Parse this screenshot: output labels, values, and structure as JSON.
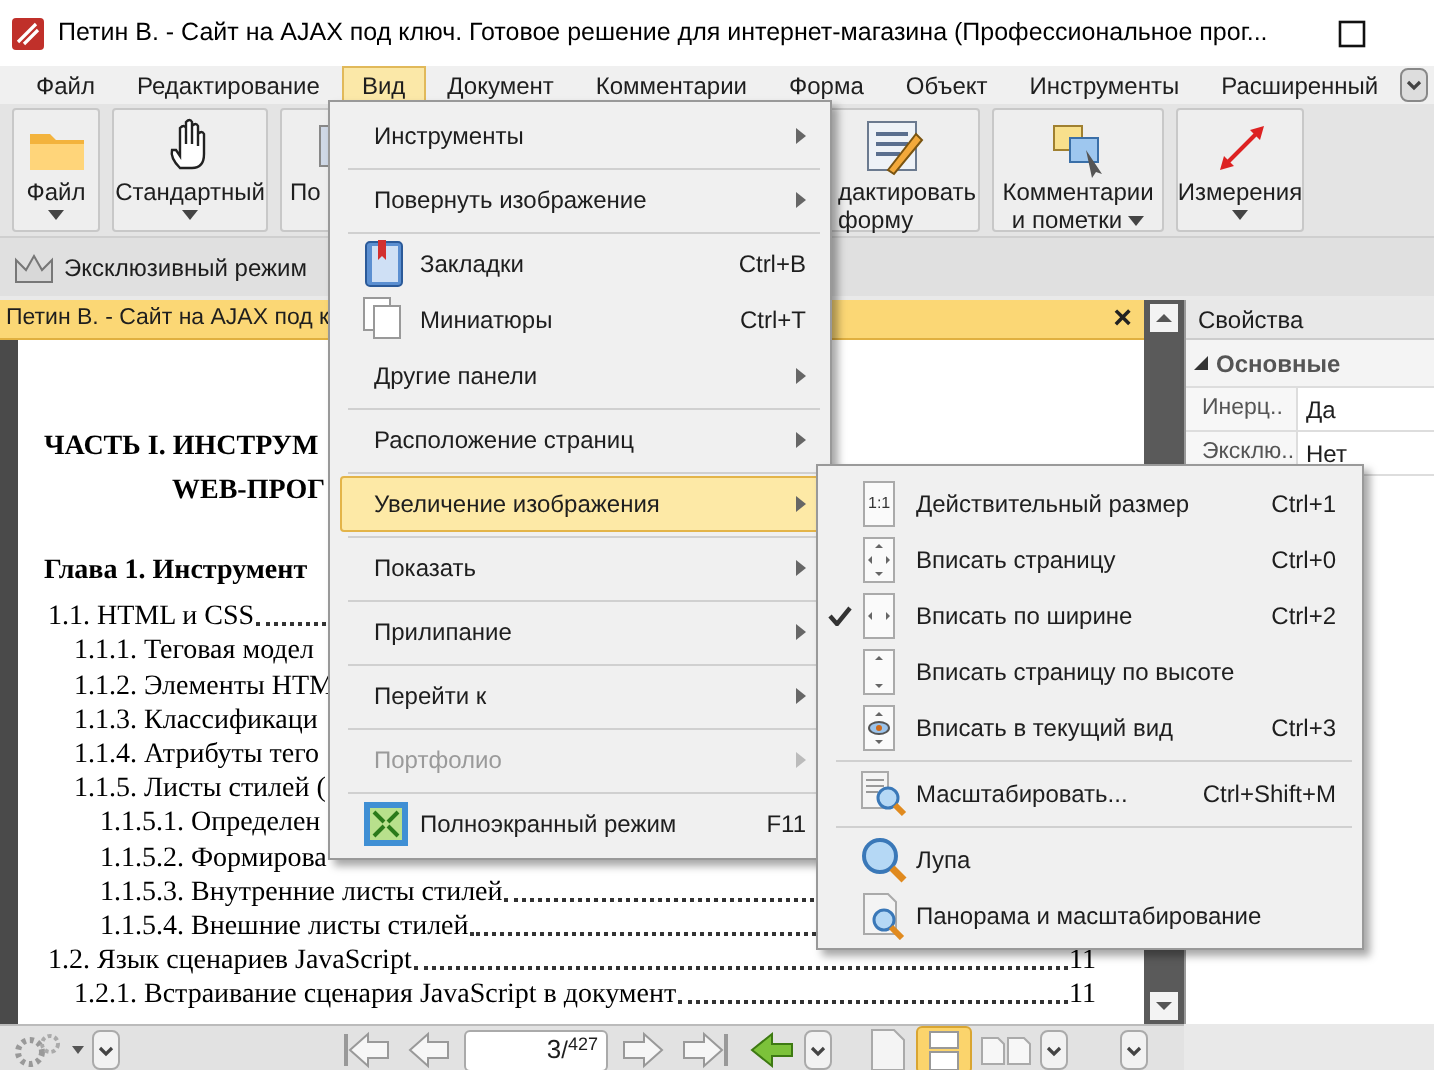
{
  "window": {
    "title": "Петин В. - Сайт на AJAX под ключ. Готовое решение для интернет-магазина (Профессиональное прог..."
  },
  "menu_bar": [
    {
      "label": "Файл",
      "selected": false
    },
    {
      "label": "Редактирование",
      "selected": false
    },
    {
      "label": "Вид",
      "selected": true
    },
    {
      "label": "Документ",
      "selected": false
    },
    {
      "label": "Комментарии",
      "selected": false
    },
    {
      "label": "Форма",
      "selected": false
    },
    {
      "label": "Объект",
      "selected": false
    },
    {
      "label": "Инструменты",
      "selected": false
    },
    {
      "label": "Расширенный",
      "selected": false
    }
  ],
  "ribbon_left": [
    {
      "label": "Файл",
      "dropdown": true
    },
    {
      "label": "Стандартный",
      "dropdown": true
    },
    {
      "label": "По"
    }
  ],
  "ribbon_right": [
    {
      "label": "дактировать форму"
    },
    {
      "label": "Комментарии и пометки",
      "dropdown": true
    },
    {
      "label": "Измерения",
      "dropdown": true
    }
  ],
  "toolbar": {
    "exclusive_mode": "Эксклюзивный режим"
  },
  "document_tab": {
    "title": "Петин В. - Сайт на AJAX под к",
    "close": "×"
  },
  "document": {
    "heading_lines": [
      "ЧАСТЬ I. ИНСТРУМ",
      "WEB-ПРОГ"
    ],
    "chapter": "Глава 1. Инструмент",
    "toc": [
      {
        "text": "1.1. HTML и CSS",
        "dots": true,
        "children": [
          {
            "text": "1.1.1. Теговая модел"
          },
          {
            "text": "1.1.2. Элементы HTM"
          },
          {
            "text": "1.1.3. Классификаци"
          },
          {
            "text": "1.1.4. Атрибуты тего"
          },
          {
            "text": "1.1.5. Листы стилей (",
            "children": [
              {
                "text": "1.1.5.1. Определен"
              },
              {
                "text": "1.1.5.2. Формирова"
              },
              {
                "text": "1.1.5.3. Внутренние листы стилей",
                "dots": true
              },
              {
                "text": "1.1.5.4. Внешние листы стилей",
                "dots": true
              }
            ]
          }
        ]
      },
      {
        "text": "1.2. Язык сценариев JavaScript",
        "dots": true,
        "page": "11",
        "children": [
          {
            "text": "1.2.1. Встраивание сценария JavaScript в документ",
            "dots": true,
            "page": "11"
          }
        ]
      }
    ]
  },
  "properties": {
    "title": "Свойства",
    "section": "Основные",
    "rows": [
      {
        "key": "Инерц..",
        "value": "Да"
      },
      {
        "key": "Эксклю..",
        "value": "Нет"
      }
    ]
  },
  "view_menu": [
    {
      "items": [
        {
          "label": "Инструменты",
          "submenu": true,
          "selected": false,
          "disabled": false
        }
      ]
    },
    {
      "items": [
        {
          "label": "Повернуть изображение",
          "submenu": true,
          "selected": false,
          "disabled": false
        }
      ]
    },
    {
      "items": [
        {
          "label": "Закладки",
          "shortcut": "Ctrl+B",
          "selected": false,
          "disabled": false
        },
        {
          "label": "Миниатюры",
          "shortcut": "Ctrl+T",
          "selected": false,
          "disabled": false
        },
        {
          "label": "Другие панели",
          "submenu": true,
          "selected": false,
          "disabled": false
        }
      ]
    },
    {
      "items": [
        {
          "label": "Расположение страниц",
          "submenu": true,
          "selected": false,
          "disabled": false
        }
      ]
    },
    {
      "items": [
        {
          "label": "Увеличение изображения",
          "submenu": true,
          "selected": true,
          "disabled": false
        }
      ]
    },
    {
      "items": [
        {
          "label": "Показать",
          "submenu": true,
          "selected": false,
          "disabled": false
        }
      ]
    },
    {
      "items": [
        {
          "label": "Прилипание",
          "submenu": true,
          "selected": false,
          "disabled": false
        }
      ]
    },
    {
      "items": [
        {
          "label": "Перейти к",
          "submenu": true,
          "selected": false,
          "disabled": false
        }
      ]
    },
    {
      "items": [
        {
          "label": "Портфолио",
          "submenu": true,
          "selected": false,
          "disabled": true
        }
      ]
    },
    {
      "items": [
        {
          "label": "Полноэкранный режим",
          "shortcut": "F11",
          "selected": false,
          "disabled": false
        }
      ]
    }
  ],
  "zoom_submenu": [
    {
      "items": [
        {
          "label": "Действительный размер",
          "shortcut": "Ctrl+1",
          "icon_text": "1:1",
          "checked": false
        },
        {
          "label": "Вписать страницу",
          "shortcut": "Ctrl+0",
          "checked": false
        },
        {
          "label": "Вписать по ширине",
          "shortcut": "Ctrl+2",
          "checked": true
        },
        {
          "label": "Вписать страницу по высоте",
          "checked": false
        },
        {
          "label": "Вписать в текущий вид",
          "shortcut": "Ctrl+3",
          "checked": false
        }
      ]
    },
    {
      "items": [
        {
          "label": "Масштабировать...",
          "shortcut": "Ctrl+Shift+M",
          "checked": false
        }
      ]
    },
    {
      "items": [
        {
          "label": "Лупа",
          "checked": false
        },
        {
          "label": "Панорама и масштабирование",
          "checked": false
        }
      ]
    }
  ],
  "status_bar": {
    "page_input": "3",
    "page_total": "/$^{427}$"
  }
}
